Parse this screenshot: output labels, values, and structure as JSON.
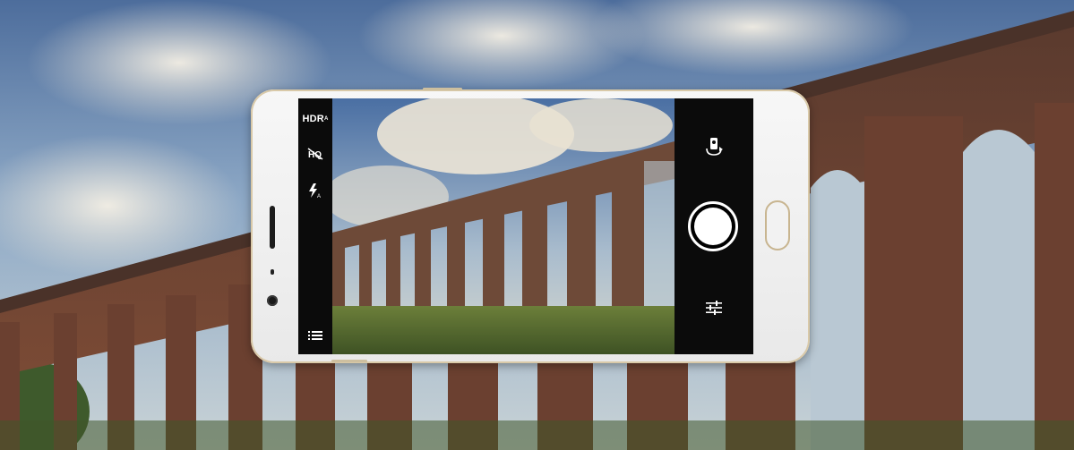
{
  "scene": {
    "background": "viaduct-sky-photo",
    "colors": {
      "sky_top": "#5a7aa6",
      "sky_mid": "#9cb6cf",
      "brick": "#7a4a35",
      "grass": "#4f6a2f",
      "phone_body": "#f2f2f2",
      "phone_trim": "#cdbf9f",
      "camera_bar": "#0b0b0b"
    }
  },
  "camera_ui": {
    "left_controls": {
      "hdr_label": "HDR",
      "hdr_sub": "A",
      "hq_icon": "hq-off-icon",
      "flash_icon": "flash-auto-icon",
      "menu_icon": "menu-list-icon"
    },
    "right_controls": {
      "switch_icon": "switch-camera-icon",
      "shutter_icon": "shutter-button",
      "settings_icon": "tune-sliders-icon"
    }
  }
}
